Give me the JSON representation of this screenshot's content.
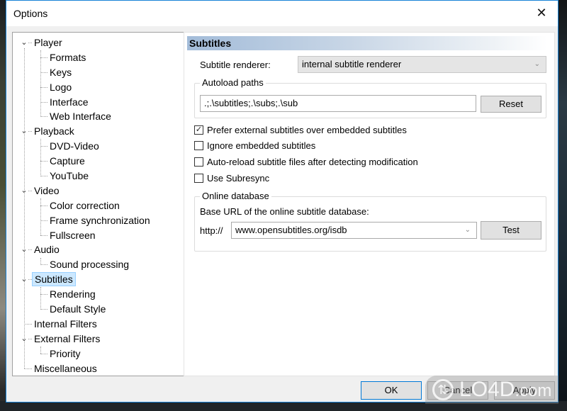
{
  "window": {
    "title": "Options",
    "close_glyph": "✕"
  },
  "tree": {
    "items": [
      {
        "label": "Player",
        "level": 0,
        "expanded": true
      },
      {
        "label": "Formats",
        "level": 1
      },
      {
        "label": "Keys",
        "level": 1
      },
      {
        "label": "Logo",
        "level": 1
      },
      {
        "label": "Interface",
        "level": 1
      },
      {
        "label": "Web Interface",
        "level": 1
      },
      {
        "label": "Playback",
        "level": 0,
        "expanded": true
      },
      {
        "label": "DVD-Video",
        "level": 1
      },
      {
        "label": "Capture",
        "level": 1
      },
      {
        "label": "YouTube",
        "level": 1
      },
      {
        "label": "Video",
        "level": 0,
        "expanded": true
      },
      {
        "label": "Color correction",
        "level": 1
      },
      {
        "label": "Frame synchronization",
        "level": 1
      },
      {
        "label": "Fullscreen",
        "level": 1
      },
      {
        "label": "Audio",
        "level": 0,
        "expanded": true
      },
      {
        "label": "Sound processing",
        "level": 1
      },
      {
        "label": "Subtitles",
        "level": 0,
        "expanded": true,
        "selected": true
      },
      {
        "label": "Rendering",
        "level": 1
      },
      {
        "label": "Default Style",
        "level": 1
      },
      {
        "label": "Internal Filters",
        "level": 0
      },
      {
        "label": "External Filters",
        "level": 0,
        "expanded": true
      },
      {
        "label": "Priority",
        "level": 1
      },
      {
        "label": "Miscellaneous",
        "level": 0
      }
    ],
    "expand_glyph": "⌄"
  },
  "panel": {
    "header": "Subtitles",
    "renderer_label": "Subtitle renderer:",
    "renderer_value": "internal subtitle renderer",
    "autoload": {
      "title": "Autoload paths",
      "value": ".;.\\subtitles;.\\subs;.\\sub",
      "reset_label": "Reset"
    },
    "checkboxes": [
      {
        "label": "Prefer external subtitles over embedded subtitles",
        "checked": true
      },
      {
        "label": "Ignore embedded subtitles",
        "checked": false
      },
      {
        "label": "Auto-reload subtitle files after detecting modification",
        "checked": false
      },
      {
        "label": "Use Subresync",
        "checked": false
      }
    ],
    "online_db": {
      "title": "Online database",
      "base_url_label": "Base URL of the online subtitle database:",
      "prefix": "http://",
      "url_value": "www.opensubtitles.org/isdb",
      "test_label": "Test"
    },
    "dropdown_glyph": "⌄"
  },
  "footer": {
    "ok_label": "OK",
    "cancel_label": "Cancel",
    "apply_label": "Apply"
  },
  "watermark": {
    "text": "LO4D",
    "suffix": ".com"
  },
  "colors": {
    "accent_border": "#1883d7",
    "selection": "#cce8ff",
    "header_gradient_start": "#a3bcd9"
  }
}
